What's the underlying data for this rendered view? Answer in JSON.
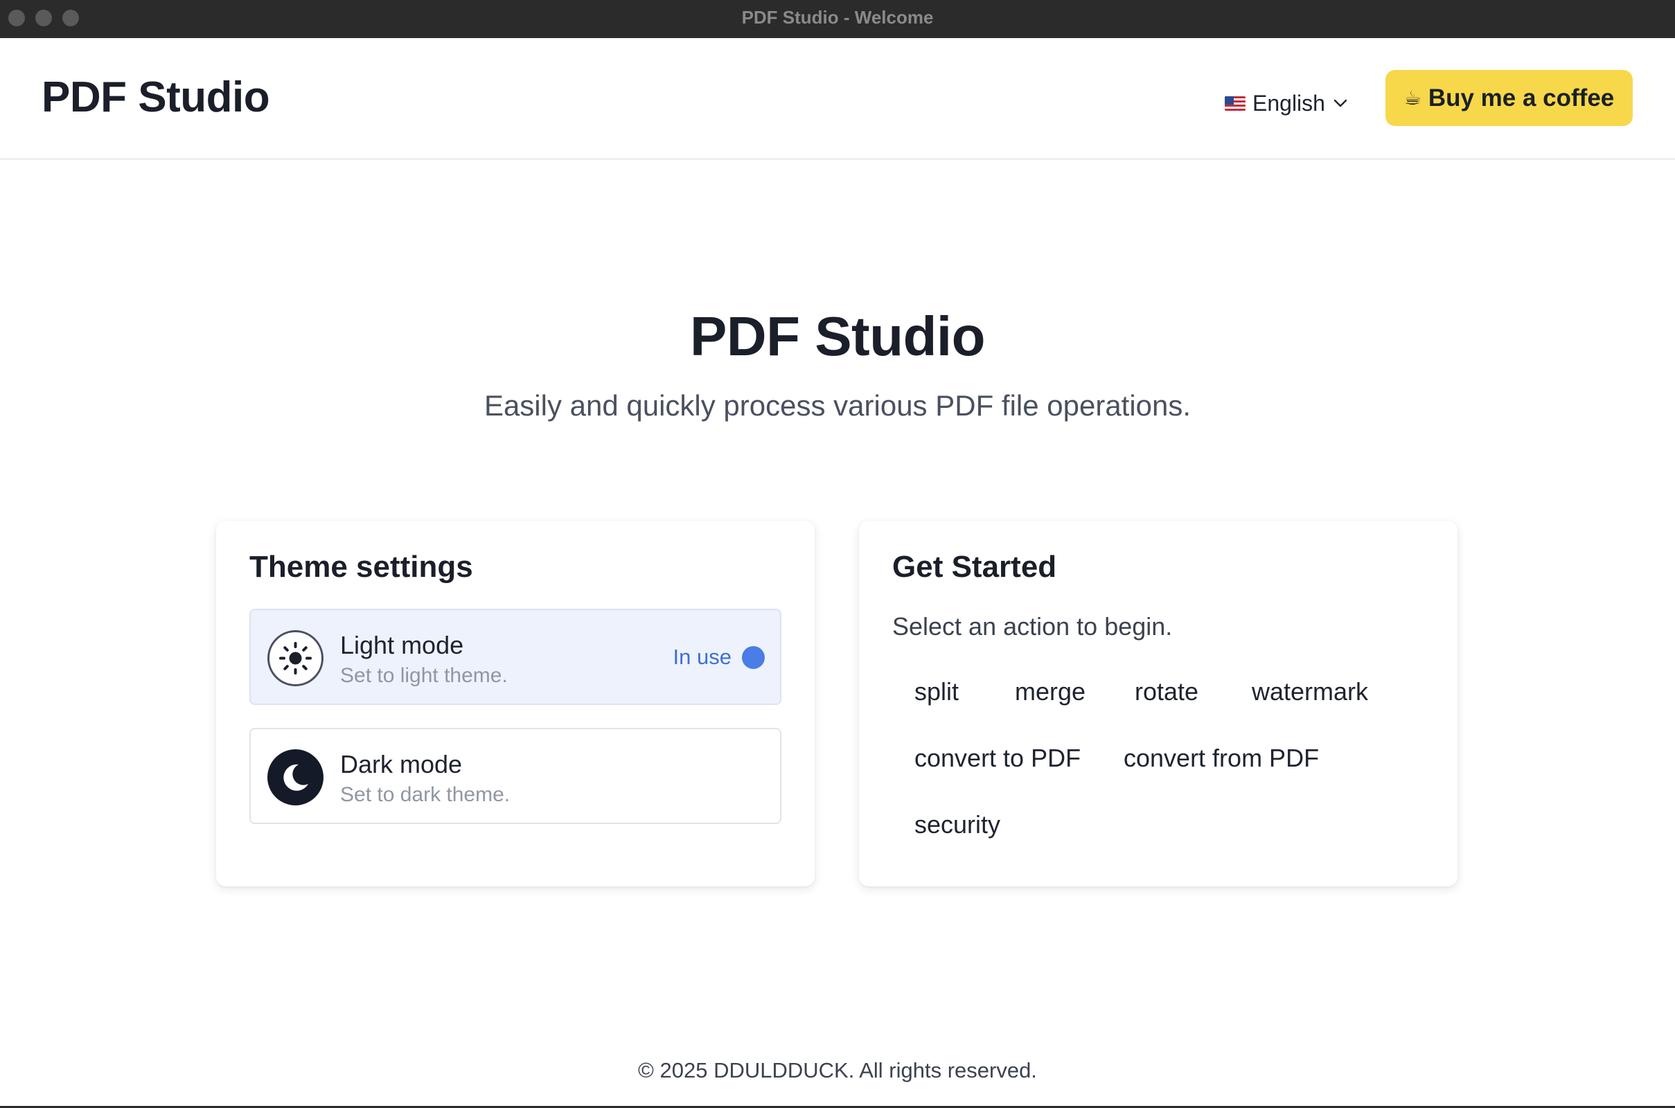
{
  "window": {
    "title": "PDF Studio - Welcome"
  },
  "header": {
    "brand": "PDF Studio",
    "language": {
      "flag_icon": "us-flag-icon",
      "label": "English"
    },
    "coffee_button": {
      "icon": "coffee-icon",
      "glyph": "☕",
      "label": "Buy me a coffee"
    }
  },
  "hero": {
    "title": "PDF Studio",
    "subtitle": "Easily and quickly process various PDF file operations."
  },
  "theme_card": {
    "title": "Theme settings",
    "options": [
      {
        "name": "Light mode",
        "description": "Set to light theme.",
        "icon": "sun-icon",
        "status": "In use"
      },
      {
        "name": "Dark mode",
        "description": "Set to dark theme.",
        "icon": "moon-icon"
      }
    ]
  },
  "start_card": {
    "title": "Get Started",
    "prompt": "Select an action to begin.",
    "actions": [
      "split",
      "merge",
      "rotate",
      "watermark",
      "convert to PDF",
      "convert from PDF",
      "security"
    ]
  },
  "footer": {
    "copyright": "© 2025 DDULDDUCK. All rights reserved."
  },
  "colors": {
    "accent": "#4a7de6",
    "coffee_button": "#f7d84a",
    "selected_option_bg": "#eef2fc",
    "titlebar": "#2b2b2b"
  }
}
